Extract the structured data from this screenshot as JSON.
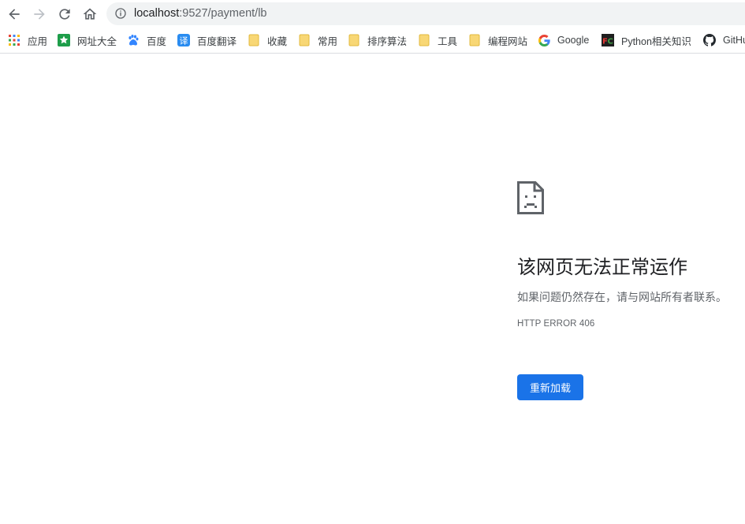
{
  "browser": {
    "url_host": "localhost",
    "url_path": ":9527/payment/lb",
    "icons": {
      "back": "arrow-left-icon",
      "forward": "arrow-right-icon",
      "reload": "reload-icon",
      "home": "home-icon",
      "site_info": "info-icon"
    }
  },
  "bookmarks": [
    {
      "label": "应用",
      "icon": "apps-grid-icon"
    },
    {
      "label": "网址大全",
      "icon": "site-favicon-icon"
    },
    {
      "label": "百度",
      "icon": "baidu-paw-icon"
    },
    {
      "label": "百度翻译",
      "icon": "translate-icon"
    },
    {
      "label": "收藏",
      "icon": "folder-icon"
    },
    {
      "label": "常用",
      "icon": "folder-icon"
    },
    {
      "label": "排序算法",
      "icon": "folder-icon"
    },
    {
      "label": "工具",
      "icon": "folder-icon"
    },
    {
      "label": "编程网站",
      "icon": "folder-icon"
    },
    {
      "label": "Google",
      "icon": "google-icon"
    },
    {
      "label": "Python相关知识",
      "icon": "fc-favicon-icon"
    },
    {
      "label": "GitHu",
      "icon": "github-icon"
    }
  ],
  "error_page": {
    "icon": "sad-page-icon",
    "title": "该网页无法正常运作",
    "description": "如果问题仍然存在，请与网站所有者联系。",
    "code": "HTTP ERROR 406",
    "reload_label": "重新加载"
  },
  "colors": {
    "accent": "#1a73e8",
    "toolbar_icon": "#5f6368",
    "folder": "#f5d76e"
  }
}
